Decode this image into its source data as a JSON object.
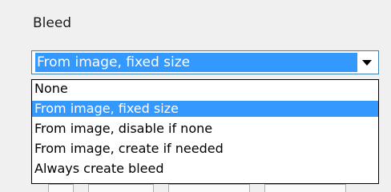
{
  "section": {
    "label": "Bleed"
  },
  "combo": {
    "value": "From image, fixed size"
  },
  "dropdown": {
    "options": [
      {
        "label": "None"
      },
      {
        "label": "From image, fixed size"
      },
      {
        "label": "From image, disable if none"
      },
      {
        "label": "From image, create if needed"
      },
      {
        "label": "Always create bleed"
      }
    ],
    "selected_index": 1
  },
  "colors": {
    "selection": "#3399ff",
    "focus_border": "#3c7fb1"
  }
}
